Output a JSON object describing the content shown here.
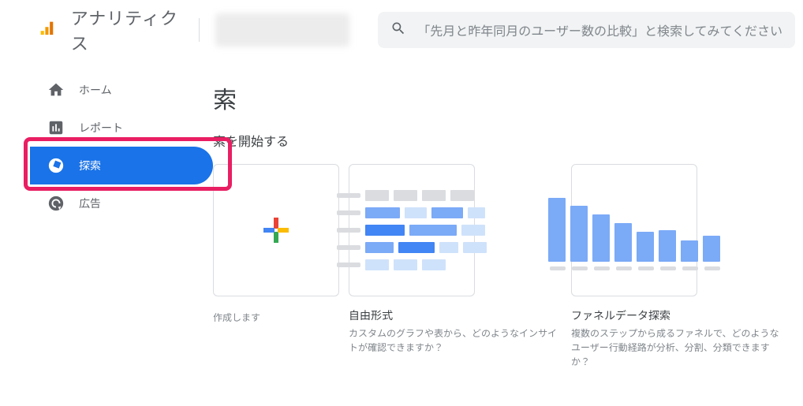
{
  "header": {
    "app_title": "アナリティクス",
    "search_placeholder": "「先月と昨年同月のユーザー数の比較」と検索してみてください"
  },
  "sidebar": {
    "items": [
      {
        "label": "ホーム",
        "icon": "home-icon"
      },
      {
        "label": "レポート",
        "icon": "report-icon"
      },
      {
        "label": "探索",
        "icon": "explore-icon",
        "active": true,
        "highlighted": true
      },
      {
        "label": "広告",
        "icon": "ads-icon"
      }
    ]
  },
  "main": {
    "page_title_fragment": "索",
    "subtitle_fragment": "索を開始する",
    "cards": [
      {
        "title": "",
        "desc_fragment": "作成します"
      },
      {
        "title": "自由形式",
        "desc": "カスタムのグラフや表から、どのようなインサイトが確認できますか？"
      },
      {
        "title": "ファネルデータ探索",
        "desc": "複数のステップから成るファネルで、どのようなユーザー行動経路が分析、分割、分類できますか？"
      }
    ]
  },
  "chart_data": [
    {
      "type": "table",
      "note": "Free-form card thumbnail: stacked horizontal bars with header placeholders, decorative only, no readable values"
    },
    {
      "type": "bar",
      "note": "Funnel exploration card thumbnail, decorative",
      "values": [
        90,
        78,
        66,
        54,
        42,
        44,
        30,
        36
      ],
      "ylim": [
        0,
        100
      ]
    }
  ],
  "colors": {
    "accent": "#1a73e8",
    "highlight": "#e91e63",
    "bar": "#7baaf7"
  }
}
